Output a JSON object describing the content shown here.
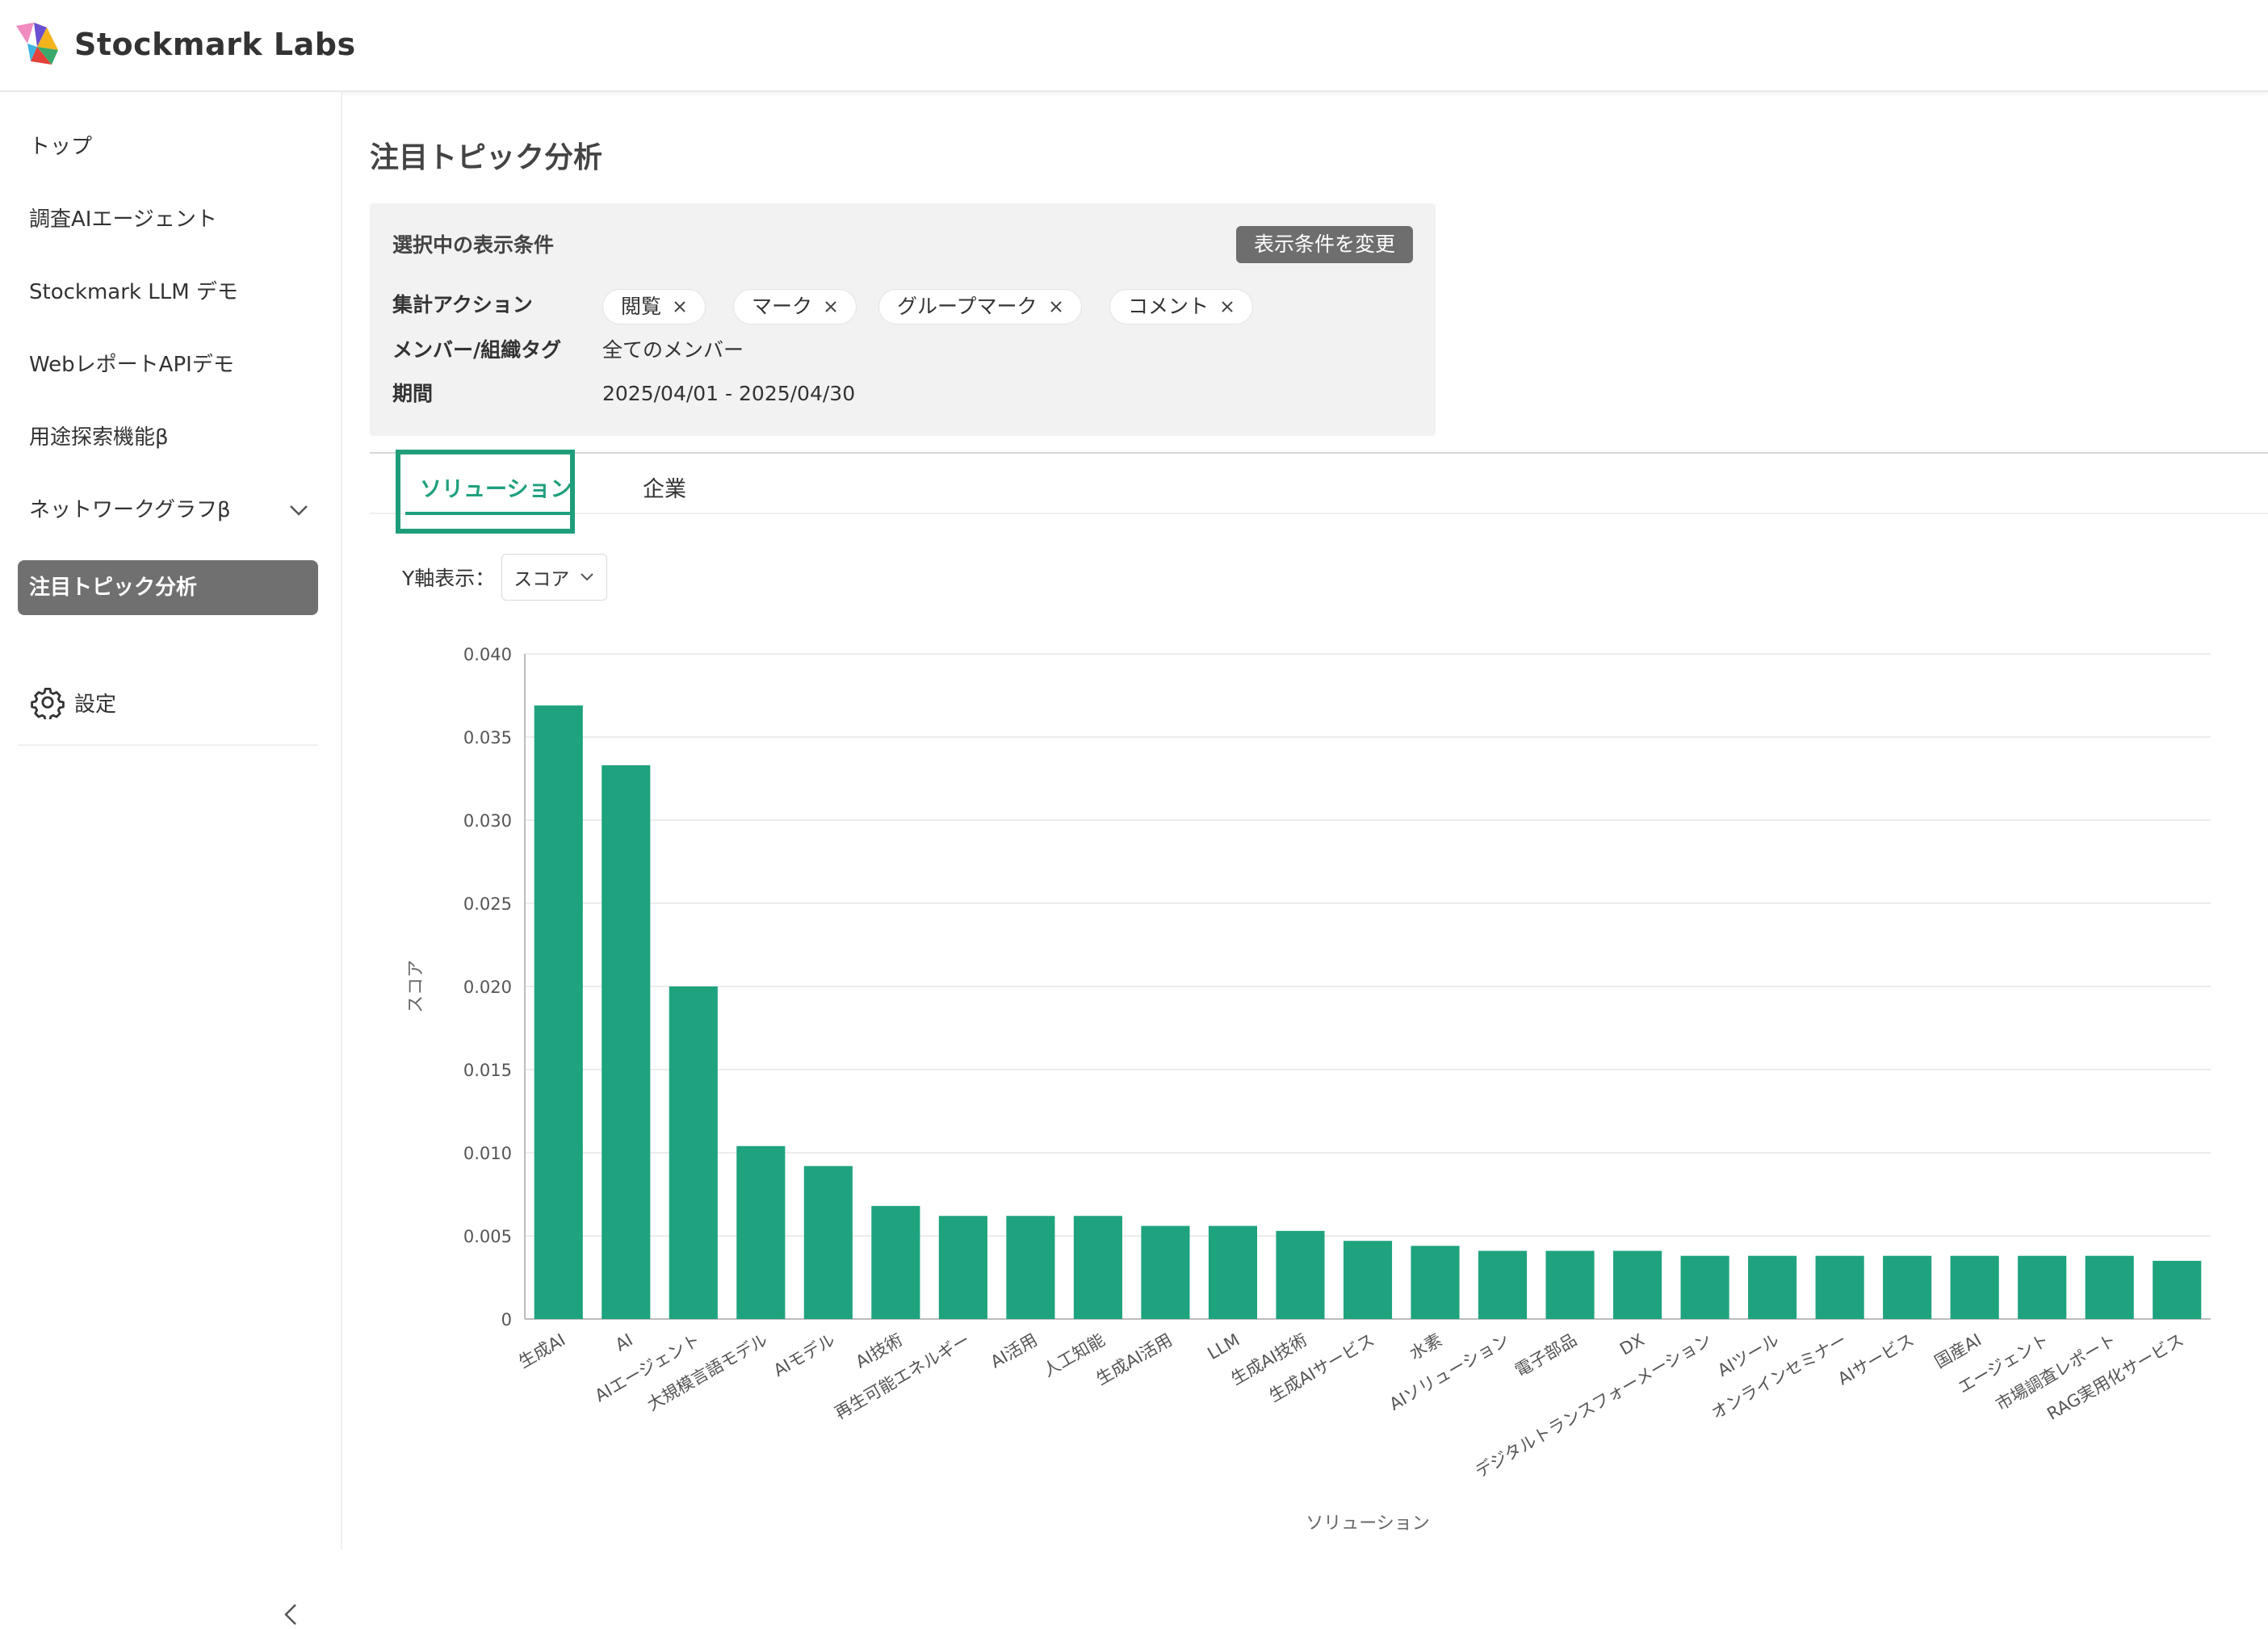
{
  "app": {
    "name": "Stockmark Labs"
  },
  "sidebar": {
    "items": [
      {
        "label": "トップ",
        "name": "sidebar-item-top"
      },
      {
        "label": "調査AIエージェント",
        "name": "sidebar-item-research-agent"
      },
      {
        "label": "Stockmark LLM デモ",
        "name": "sidebar-item-llm-demo"
      },
      {
        "label": "WebレポートAPIデモ",
        "name": "sidebar-item-web-report-api"
      },
      {
        "label": "用途探索機能β",
        "name": "sidebar-item-use-exploration"
      },
      {
        "label": "ネットワークグラフβ",
        "name": "sidebar-item-network-graph"
      },
      {
        "label": "注目トピック分析",
        "name": "sidebar-item-topic-analysis"
      }
    ],
    "settings_label": "設定"
  },
  "page": {
    "title": "注目トピック分析"
  },
  "filters": {
    "heading": "選択中の表示条件",
    "change_button": "表示条件を変更",
    "action_label": "集計アクション",
    "action_chips": [
      "閲覧",
      "マーク",
      "グループマーク",
      "コメント"
    ],
    "member_label": "メンバー/組織タグ",
    "member_value": "全てのメンバー",
    "period_label": "期間",
    "period_value": "2025/04/01 - 2025/04/30"
  },
  "tabs": [
    {
      "label": "ソリューション",
      "active": true
    },
    {
      "label": "企業",
      "active": false
    }
  ],
  "yaxis_control": {
    "label": "Y軸表示：",
    "selected": "スコア"
  },
  "colors": {
    "accent": "#20a07e",
    "bar": "#1fa37f",
    "active_nav": "#707070"
  },
  "chart_data": {
    "type": "bar",
    "xlabel": "ソリューション",
    "ylabel": "スコア",
    "ylim": [
      0,
      0.04
    ],
    "yticks": [
      "0",
      "0.005",
      "0.010",
      "0.015",
      "0.020",
      "0.025",
      "0.030",
      "0.035",
      "0.040"
    ],
    "grid": true,
    "categories": [
      "生成AI",
      "AI",
      "AIエージェント",
      "大規模言語モデル",
      "AIモデル",
      "AI技術",
      "再生可能エネルギー",
      "AI活用",
      "人工知能",
      "生成AI活用",
      "LLM",
      "生成AI技術",
      "生成AIサービス",
      "水素",
      "AIソリューション",
      "電子部品",
      "DX",
      "デジタルトランスフォーメーション",
      "AIツール",
      "オンラインセミナー",
      "AIサービス",
      "国産AI",
      "エージェント",
      "市場調査レポート",
      "RAG実用化サービス"
    ],
    "values": [
      0.0369,
      0.0333,
      0.02,
      0.0104,
      0.0092,
      0.0068,
      0.0062,
      0.0062,
      0.0062,
      0.0056,
      0.0056,
      0.0053,
      0.0047,
      0.0044,
      0.0041,
      0.0041,
      0.0041,
      0.0038,
      0.0038,
      0.0038,
      0.0038,
      0.0038,
      0.0038,
      0.0038,
      0.0035
    ]
  }
}
